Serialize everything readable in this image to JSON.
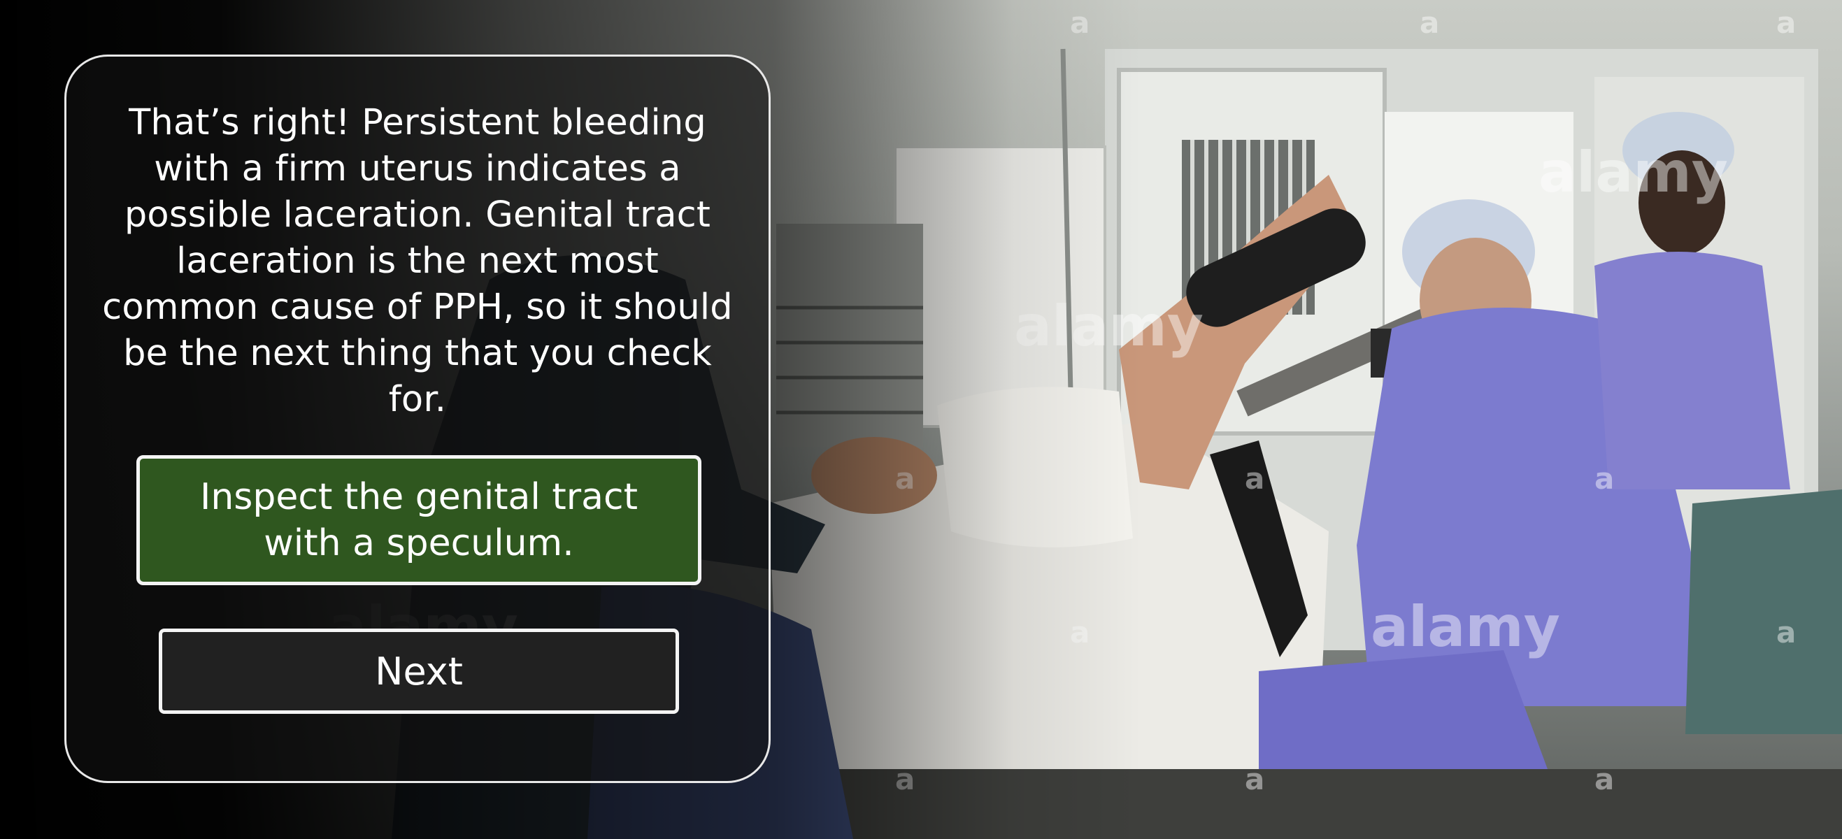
{
  "dialog": {
    "feedback_text": "That’s right! Persistent bleeding with a firm uterus indicates a possible laceration. Genital tract laceration is the next most common cause of PPH, so it should be the next thing that you check for.",
    "selected_answer_label": "Inspect the genital tract with a speculum.",
    "next_label": "Next"
  },
  "background": {
    "watermark_text": "alamy",
    "watermark_letter": "a",
    "selected_answer_color": "#2f571f"
  }
}
